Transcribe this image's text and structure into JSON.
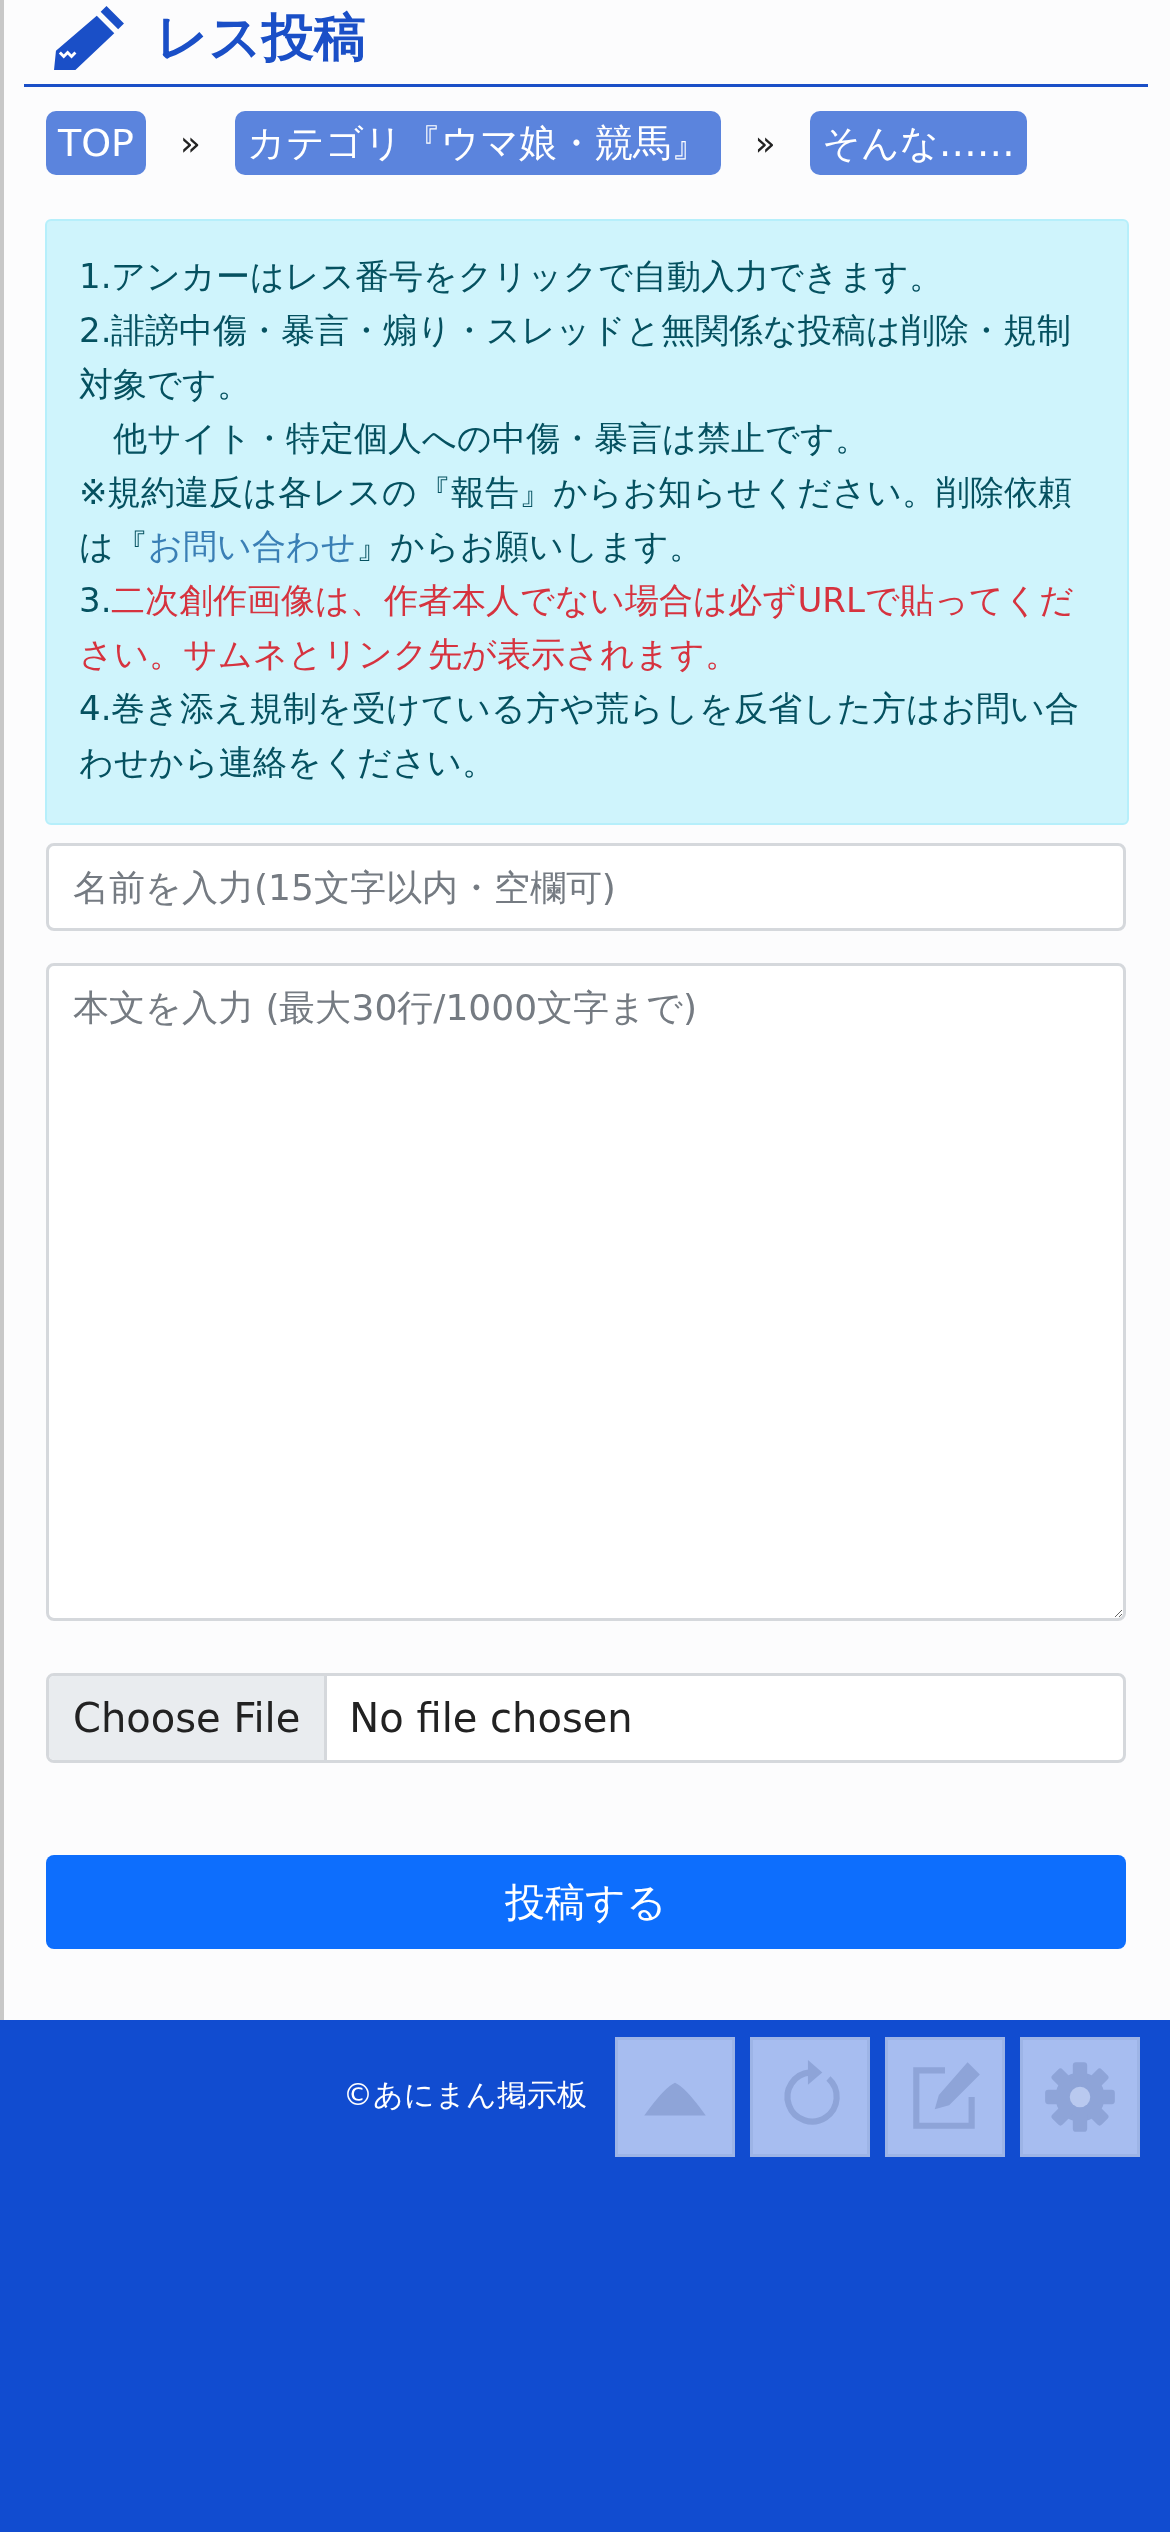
{
  "header": {
    "title": "レス投稿"
  },
  "breadcrumbs": [
    {
      "label": "TOP",
      "separator_after": "»"
    },
    {
      "label": "カテゴリ『ウマ娘・競馬』",
      "separator_after": "»"
    },
    {
      "label": "そんな……"
    }
  ],
  "notice": [
    {
      "segments": [
        {
          "kind": "plain",
          "text": "1.アンカーはレス番号をクリックで自動入力できます。"
        }
      ]
    },
    {
      "segments": [
        {
          "kind": "plain",
          "text": "2.誹謗中傷・暴言・煽り・スレッドと無関係な投稿は削除・規制対象です。"
        }
      ]
    },
    {
      "segments": [
        {
          "kind": "plain",
          "text": "　他サイト・特定個人への中傷・暴言は禁止です。"
        }
      ]
    },
    {
      "segments": [
        {
          "kind": "plain",
          "text": "※規約違反は各レスの『報告』からお知らせください。削除依頼は『"
        },
        {
          "kind": "link",
          "text": "お問い合わせ"
        },
        {
          "kind": "plain",
          "text": "』からお願いします。"
        }
      ]
    },
    {
      "segments": [
        {
          "kind": "plain",
          "text": "3."
        },
        {
          "kind": "alert",
          "text": "二次創作画像は、作者本人でない場合は必ずURLで貼ってください。サムネとリンク先が表示されます。"
        }
      ]
    },
    {
      "segments": [
        {
          "kind": "plain",
          "text": "4.巻き添え規制を受けている方や荒らしを反省した方はお問い合わせから連絡をください。"
        }
      ]
    }
  ],
  "form": {
    "name": {
      "placeholder": "名前を入力(15文字以内・空欄可)"
    },
    "body": {
      "placeholder": "本文を入力 (最大30行/1000文字まで)"
    },
    "file": {
      "button": "Choose File",
      "status": "No file chosen"
    },
    "submit": "投稿する"
  },
  "footer": {
    "copyright": "©あにまん掲示板"
  },
  "floating_buttons": [
    {
      "kind": "up"
    },
    {
      "kind": "reload"
    },
    {
      "kind": "compose"
    },
    {
      "kind": "settings"
    }
  ]
}
